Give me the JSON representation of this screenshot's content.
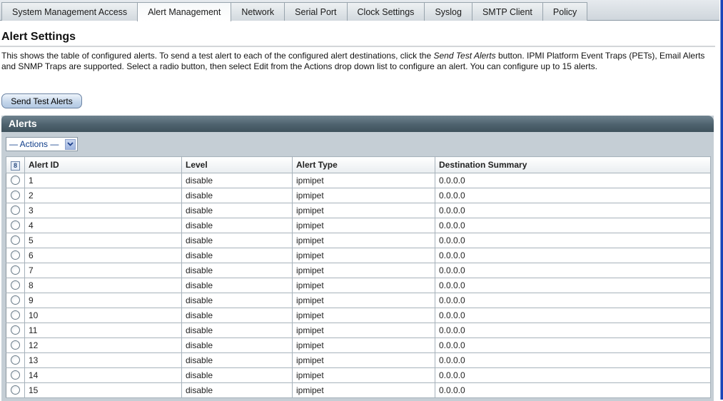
{
  "tabs": [
    {
      "label": "System Management Access",
      "active": false
    },
    {
      "label": "Alert Management",
      "active": true
    },
    {
      "label": "Network",
      "active": false
    },
    {
      "label": "Serial Port",
      "active": false
    },
    {
      "label": "Clock Settings",
      "active": false
    },
    {
      "label": "Syslog",
      "active": false
    },
    {
      "label": "SMTP Client",
      "active": false
    },
    {
      "label": "Policy",
      "active": false
    }
  ],
  "page": {
    "title": "Alert Settings",
    "description_part1": "This shows the table of configured alerts. To send a test alert to each of the configured alert destinations, click the ",
    "description_em": "Send Test Alerts",
    "description_part2": " button. IPMI Platform Event Traps (PETs), Email Alerts and SNMP Traps are supported. Select a radio button, then select Edit from the Actions drop down list to configure an alert. You can configure up to 15 alerts.",
    "send_test_button": "Send Test Alerts"
  },
  "alerts_panel": {
    "title": "Alerts",
    "actions_select": "— Actions —",
    "select_all_icon": "8",
    "columns": [
      "Alert ID",
      "Level",
      "Alert Type",
      "Destination Summary"
    ],
    "rows": [
      {
        "id": "1",
        "level": "disable",
        "type": "ipmipet",
        "dest": "0.0.0.0"
      },
      {
        "id": "2",
        "level": "disable",
        "type": "ipmipet",
        "dest": "0.0.0.0"
      },
      {
        "id": "3",
        "level": "disable",
        "type": "ipmipet",
        "dest": "0.0.0.0"
      },
      {
        "id": "4",
        "level": "disable",
        "type": "ipmipet",
        "dest": "0.0.0.0"
      },
      {
        "id": "5",
        "level": "disable",
        "type": "ipmipet",
        "dest": "0.0.0.0"
      },
      {
        "id": "6",
        "level": "disable",
        "type": "ipmipet",
        "dest": "0.0.0.0"
      },
      {
        "id": "7",
        "level": "disable",
        "type": "ipmipet",
        "dest": "0.0.0.0"
      },
      {
        "id": "8",
        "level": "disable",
        "type": "ipmipet",
        "dest": "0.0.0.0"
      },
      {
        "id": "9",
        "level": "disable",
        "type": "ipmipet",
        "dest": "0.0.0.0"
      },
      {
        "id": "10",
        "level": "disable",
        "type": "ipmipet",
        "dest": "0.0.0.0"
      },
      {
        "id": "11",
        "level": "disable",
        "type": "ipmipet",
        "dest": "0.0.0.0"
      },
      {
        "id": "12",
        "level": "disable",
        "type": "ipmipet",
        "dest": "0.0.0.0"
      },
      {
        "id": "13",
        "level": "disable",
        "type": "ipmipet",
        "dest": "0.0.0.0"
      },
      {
        "id": "14",
        "level": "disable",
        "type": "ipmipet",
        "dest": "0.0.0.0"
      },
      {
        "id": "15",
        "level": "disable",
        "type": "ipmipet",
        "dest": "0.0.0.0"
      }
    ]
  }
}
